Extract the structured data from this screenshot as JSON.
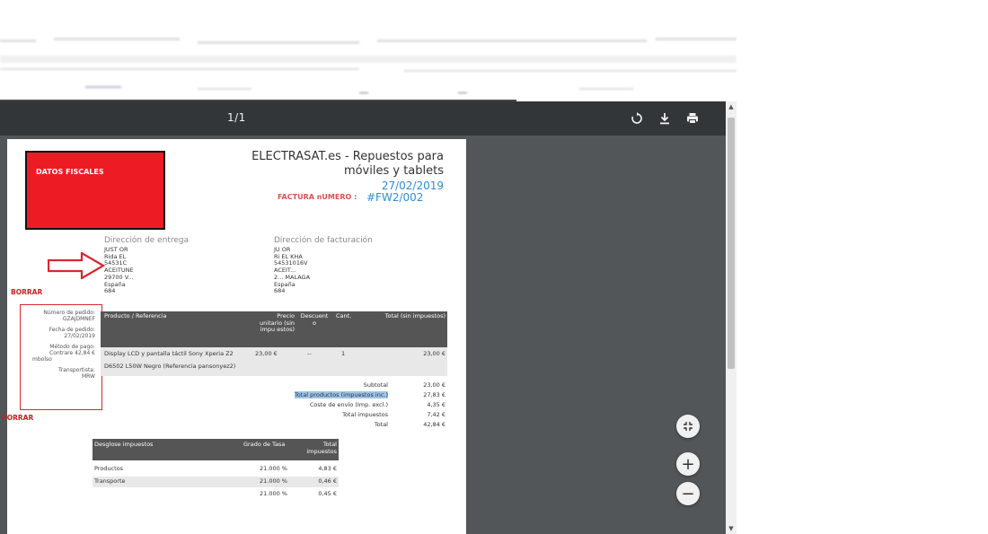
{
  "toolbar": {
    "page_indicator": "1/1",
    "rotate_icon": "rotate-icon",
    "download_icon": "download-icon",
    "print_icon": "print-icon"
  },
  "document": {
    "fiscal_box_label": "DATOS FISCALES",
    "company_line1": "ELECTRASAT.es - Repuestos para",
    "company_line2": "móviles y tablets",
    "date": "27/02/2019",
    "invoice_label": "FACTURA nUMERO :",
    "invoice_number": "#FW2/002",
    "shipping_title": "Dirección de entrega",
    "shipping_lines": [
      "JUST OR",
      "Rida EL",
      "54531C",
      "ACEITUNE",
      "29700 V...",
      "España",
      "684"
    ],
    "billing_title": "Dirección de facturación",
    "billing_lines": [
      "JU   OR",
      "Ri    EL KHA",
      "54531016V",
      "ACEIT...",
      "2...       MALAGA",
      "España",
      "684"
    ],
    "borrar_label_1": "BORRAR",
    "borrar_label_2": "BORRAR",
    "order_number_label": "Número de pedido:",
    "order_number_value": "GZAJDMNEF",
    "order_date_label": "Fecha de pedido:",
    "order_date_value": "27/02/2019",
    "payment_method_label": "Método de pago:",
    "payment_method_value": "Contrare   42,84 €",
    "payment_method_value2": "mbolso",
    "carrier_label": "Transportista:",
    "carrier_value": "MRW",
    "products_table": {
      "headers": {
        "product": "Producto / Referencia",
        "unit_price": "Precio unitario (sin impu estos)",
        "discount": "Descuent o",
        "qty": "Cant.",
        "total": "Total (sin impuestos)"
      },
      "row": {
        "product_line1": "Display LCD y pantalla táctil Sony Xperia Z2",
        "product_line2": "D6502 L50W Negro (Referencia pansonyez2)",
        "unit_price": "23,00 €",
        "discount": "--",
        "qty": "1",
        "total": "23,00 €"
      }
    },
    "totals": [
      {
        "label": "Subtotal",
        "value": "23,00 €"
      },
      {
        "label": "Total productos (impuestos inc.)",
        "value": "27,83 €"
      },
      {
        "label": "Coste de envío (Imp. excl.)",
        "value": "4,35 €"
      },
      {
        "label": "Total impuestos",
        "value": "7,42 €"
      },
      {
        "label": "Total",
        "value": "42,84 €"
      }
    ],
    "tax_table": {
      "headers": {
        "breakdown": "Desglose impuestos",
        "rate": "Grado de Tasa",
        "total": "Total impuestos"
      },
      "rows": [
        {
          "name": "Productos",
          "rate": "21.000 %",
          "total": "4,83 €"
        },
        {
          "name": "Transporte",
          "rate": "21.000 %",
          "total": "0,46 €"
        },
        {
          "name": "",
          "rate": "21.000 %",
          "total": "0,45 €"
        }
      ]
    }
  },
  "zoom_controls": {
    "fit_icon": "fit-to-page-icon",
    "zoom_in": "+",
    "zoom_out": "−"
  }
}
